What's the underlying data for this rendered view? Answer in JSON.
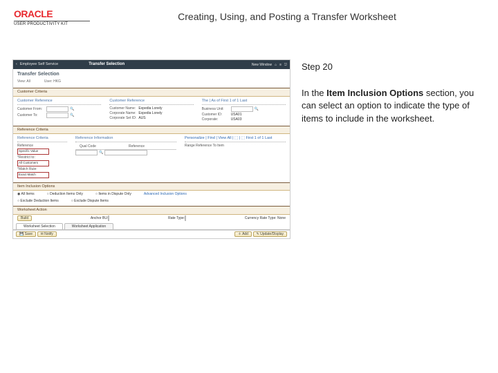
{
  "header": {
    "logo_brand": "ORACLE",
    "logo_subtitle": "USER PRODUCTIVITY KIT",
    "page_title": "Creating, Using, and Posting a Transfer Worksheet"
  },
  "info": {
    "step_label": "Step 20",
    "instruction_prefix": "In the ",
    "instruction_bold": "Item Inclusion Options",
    "instruction_suffix": " section, you can select an option to indicate the type of items to include in the worksheet."
  },
  "screenshot": {
    "topbar": {
      "back": "‹",
      "app": "Employee Self Service",
      "title": "Transfer Selection",
      "new_window": "New Window",
      "home": "⌂",
      "nav": "≡",
      "sign_out": "⎋"
    },
    "page_title": "Transfer Selection",
    "sub": {
      "view": "View:",
      "view_val": "All",
      "user": "User:",
      "user_val": "HKG"
    },
    "customer_section": {
      "header": "Customer Criteria",
      "col1": "Customer Reference",
      "col1_rows": [
        {
          "label": "Customer From:"
        },
        {
          "label": "Customer To:"
        }
      ],
      "col2": "Customer Reference",
      "col2_rows": [
        {
          "label": "Customer Name:",
          "val": "Expedia  Lonely"
        },
        {
          "label": "Corporate Name:",
          "val": "Expedia  Lonely"
        },
        {
          "label": "Corporate Set ID:",
          "val": "AUS"
        }
      ],
      "col3_rows": [
        {
          "lbl": "The | As of   First   1  of  1   Last"
        },
        {
          "lbl": "Business Unit:"
        },
        {
          "lbl": "Customer ID:",
          "val": "USA01"
        },
        {
          "lbl": "Corporate:",
          "val": "USA03"
        }
      ]
    },
    "reference_section": {
      "header": "Reference Criteria",
      "left_header": "Reference Criteria",
      "ref_label": "Reference",
      "ref_options": [
        "Specific Value"
      ],
      "restrict_label": "*Restrict to:",
      "restrict_options": [
        "All Customers"
      ],
      "match_label": "*Match Rule:",
      "match_options": [
        "Exact Match"
      ],
      "mid_header": "Reference Information",
      "mid_cols": [
        "Qual Code",
        "Reference"
      ],
      "right_header": "Personalize | Find | View All | ⬚ | ⬚   First   1  of  1   Last",
      "right_label": "Range Reference To Item"
    },
    "item_section": {
      "header": "Item Inclusion Options",
      "options": [
        "All Items",
        "Deduction Items Only",
        "Items in Dispute Only",
        "Exclude Deduction Items",
        "Exclude Dispute Items"
      ],
      "advanced": "Advanced Inclusion Options"
    },
    "worksheet_section": {
      "header": "Worksheet Action",
      "lbl_left": "Build",
      "lbl_mid1": "Anchor BU:",
      "lbl_mid2": "Rate Type:",
      "lbl_right": "Currency Rate Type:",
      "lbl_far": "None"
    },
    "tabs": [
      "Worksheet Selection",
      "Worksheet Application"
    ],
    "footer": {
      "save": "Save",
      "notify": "Notify",
      "add": "Add",
      "update": "Update/Display"
    }
  }
}
